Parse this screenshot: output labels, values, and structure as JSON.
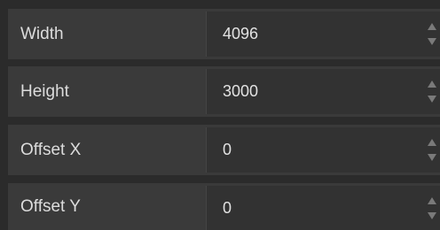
{
  "params": [
    {
      "label": "Width",
      "value": "4096"
    },
    {
      "label": "Height",
      "value": "3000"
    },
    {
      "label": "Offset X",
      "value": "0"
    },
    {
      "label": "Offset Y",
      "value": "0"
    }
  ],
  "icons": {
    "increment": "spin-up-icon",
    "decrement": "spin-down-icon"
  },
  "colors": {
    "background": "#2b2b2b",
    "row": "#3a3a3a",
    "field": "#323232",
    "text": "#dcdcdc",
    "spin_arrow": "#7a7a7a"
  }
}
